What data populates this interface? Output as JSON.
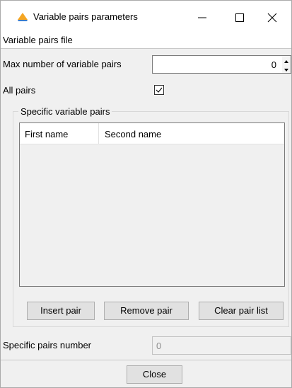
{
  "window": {
    "title": "Variable pairs parameters",
    "controls": {
      "minimize": "—",
      "maximize": "☐",
      "close": "✕"
    }
  },
  "menu": {
    "file_label": "Variable pairs file"
  },
  "max_pairs": {
    "label": "Max number of variable pairs",
    "value": "0"
  },
  "all_pairs": {
    "label": "All pairs",
    "checked": true
  },
  "specific_pairs_group": {
    "title": "Specific variable pairs",
    "columns": [
      "First name",
      "Second name"
    ],
    "rows": []
  },
  "buttons": {
    "insert_pair": "Insert pair",
    "remove_pair": "Remove pair",
    "clear_pair_list": "Clear pair list",
    "close": "Close"
  },
  "specific_pairs_number": {
    "label": "Specific pairs number",
    "value": "0"
  },
  "colors": {
    "window_bg": "#f0f0f0",
    "titlebar_bg": "#ffffff",
    "button_bg": "#e1e1e1",
    "app_icon": "#f0a030"
  },
  "icons": {
    "app": "java-cup-icon",
    "checkbox": "checkmark-icon",
    "spinner_up": "arrow-up-icon",
    "spinner_down": "arrow-down-icon"
  }
}
